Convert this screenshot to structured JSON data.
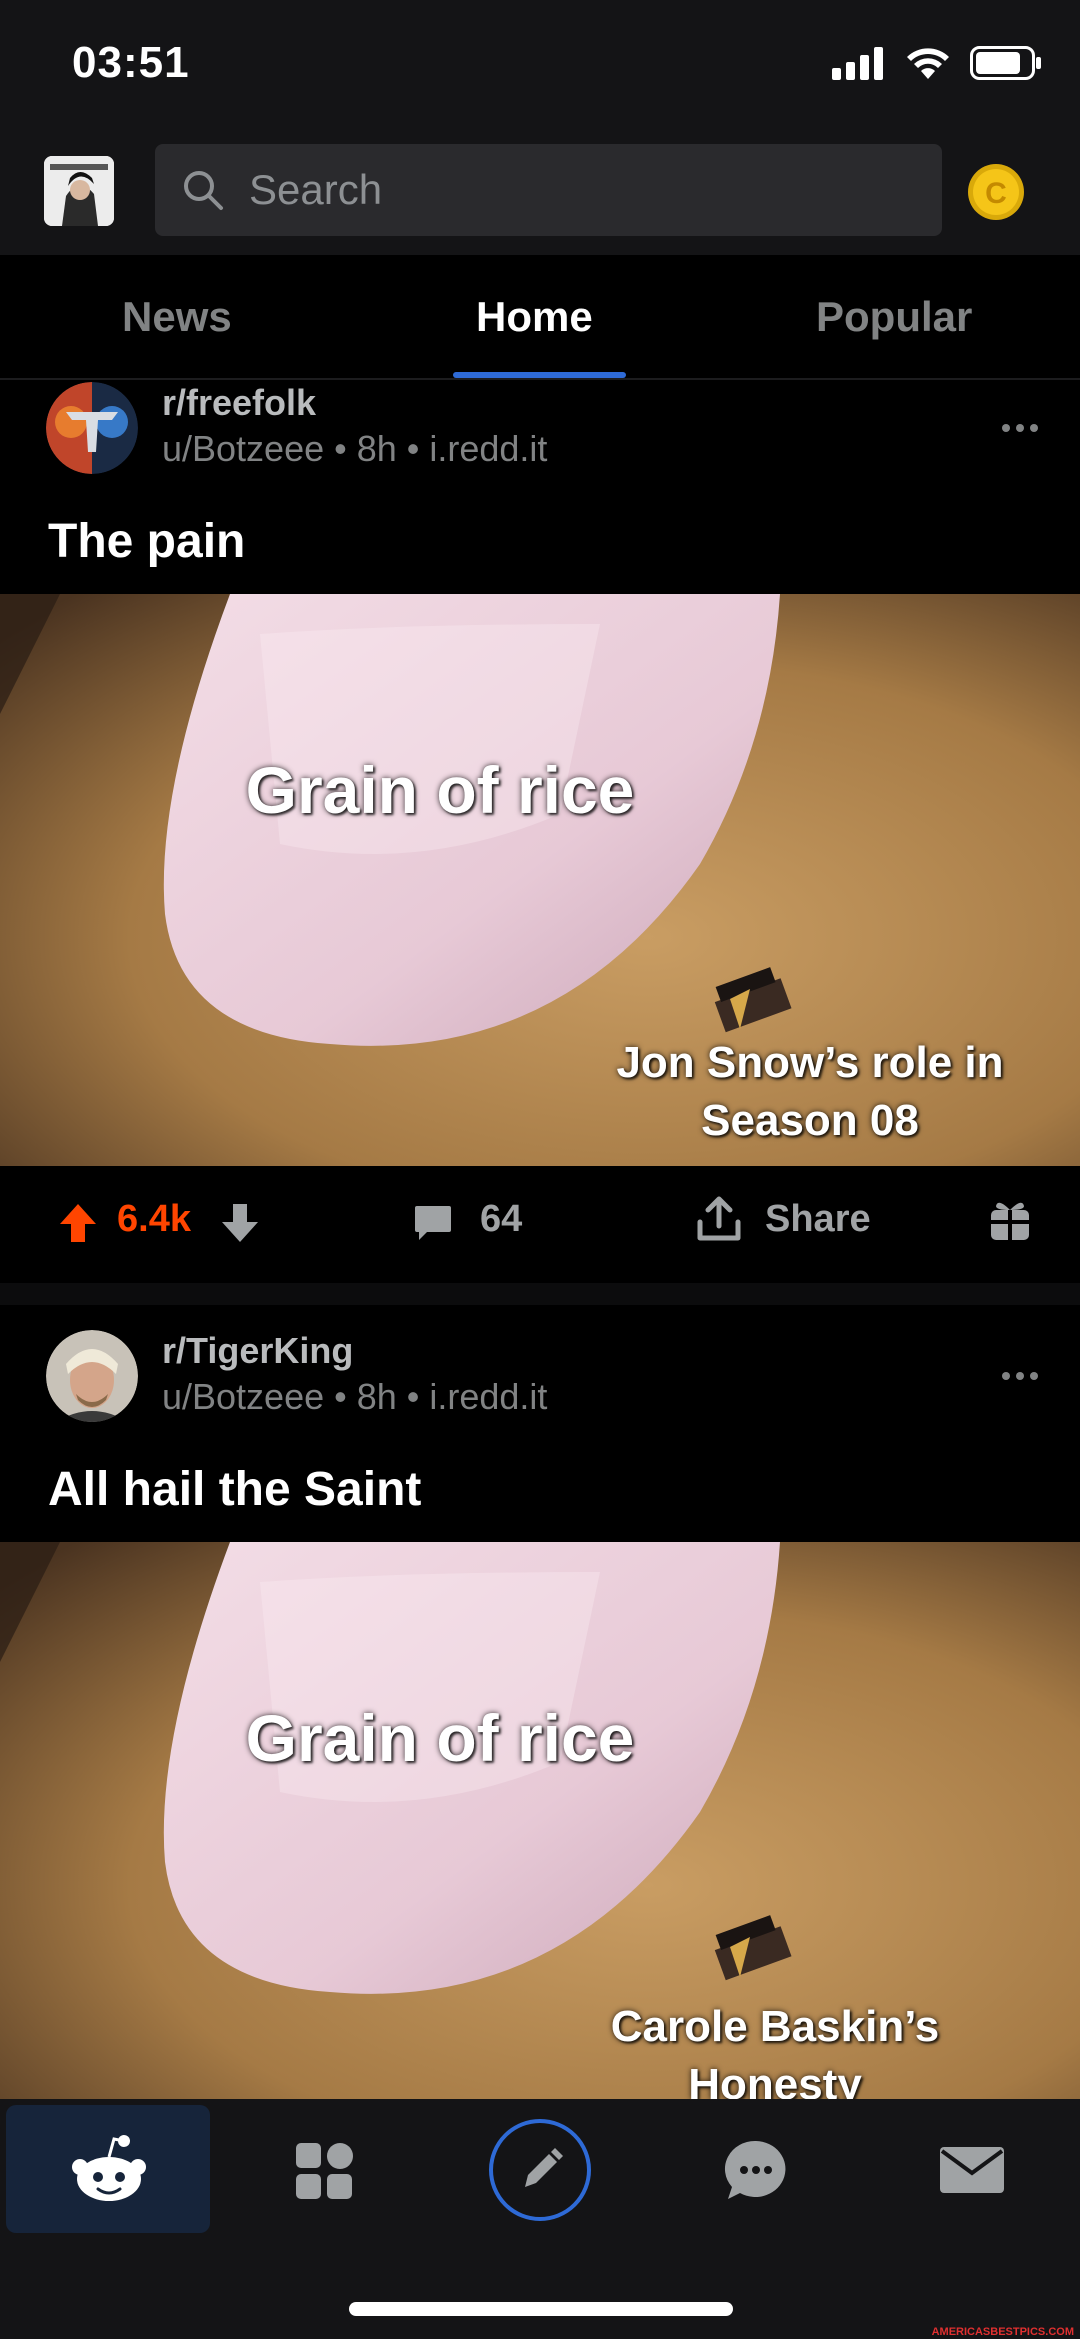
{
  "status_bar": {
    "time": "03:51"
  },
  "header": {
    "search_placeholder": "Search"
  },
  "tabs": [
    {
      "label": "News"
    },
    {
      "label": "Home"
    },
    {
      "label": "Popular"
    }
  ],
  "posts": [
    {
      "subreddit": "r/freefolk",
      "meta": "u/Botzeee • 8h • i.redd.it",
      "title": "The pain",
      "image_caption_top": "Grain of rice",
      "image_caption_bottom_1": "Jon Snow’s role in",
      "image_caption_bottom_2": "Season 08",
      "votes": "6.4k",
      "comments": "64",
      "share_label": "Share"
    },
    {
      "subreddit": "r/TigerKing",
      "meta": "u/Botzeee • 8h • i.redd.it",
      "title": "All hail the Saint",
      "image_caption_top": "Grain of rice",
      "image_caption_bottom_1": "Carole Baskin’s",
      "image_caption_bottom_2": "Honesty"
    }
  ],
  "watermark": "AMERICASBESTPICS.COM",
  "colors": {
    "accent": "#2e6ad6",
    "upvote": "#ff4500",
    "background": "#000000",
    "bar": "#141416"
  }
}
